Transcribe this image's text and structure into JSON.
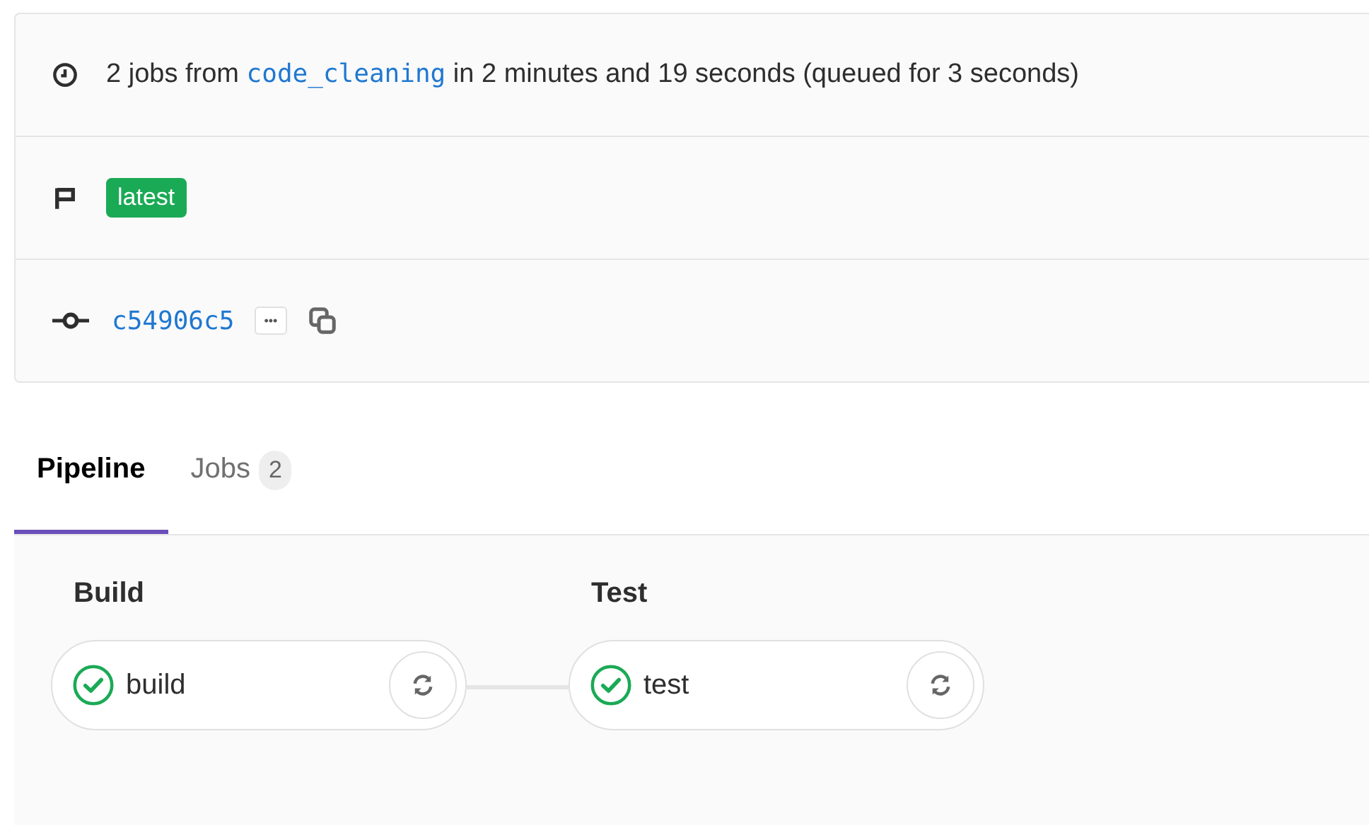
{
  "summary": {
    "prefix": "2 jobs from",
    "branch": "code_cleaning",
    "suffix": "in 2 minutes and 19 seconds (queued for 3 seconds)"
  },
  "tags": [
    {
      "label": "latest",
      "color": "#1aaa55"
    }
  ],
  "commit": {
    "sha": "c54906c5",
    "ellipsis": "•••"
  },
  "tabs": [
    {
      "label": "Pipeline",
      "selected": true
    },
    {
      "label": "Jobs",
      "count": "2",
      "selected": false
    }
  ],
  "stages": [
    {
      "name": "Build",
      "jobs": [
        {
          "name": "build",
          "passed": true
        }
      ]
    },
    {
      "name": "Test",
      "jobs": [
        {
          "name": "test",
          "passed": true
        }
      ]
    }
  ]
}
